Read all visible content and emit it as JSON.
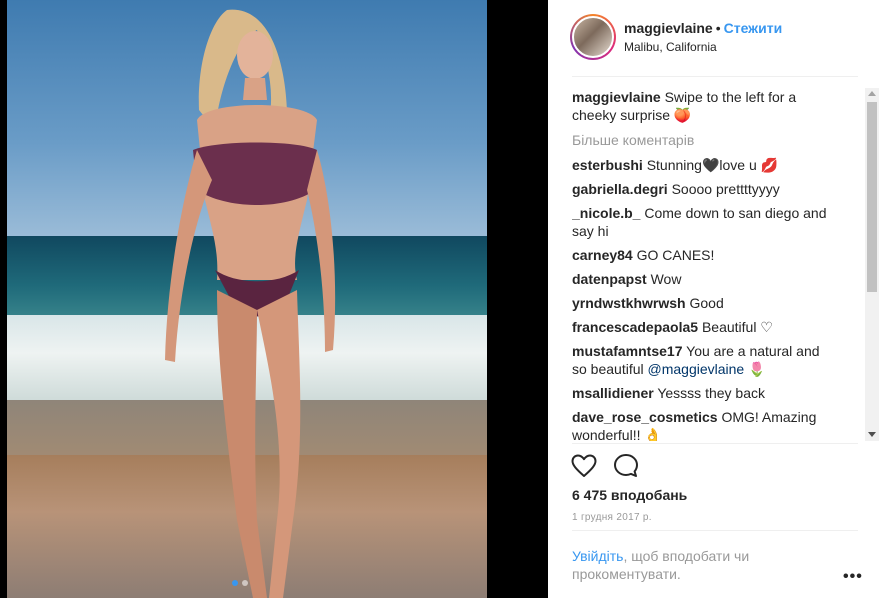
{
  "post": {
    "username": "maggievlaine",
    "separator": "•",
    "follow_label": "Стежити",
    "location": "Malibu, California",
    "caption_user": "maggievlaine",
    "caption_text": "Swipe to the left for a cheeky surprise 🍑",
    "more_comments_label": "Більше коментарів",
    "likes_text": "6 475 вподобань",
    "date_text": "1 грудня 2017 р.",
    "login_link": "Увійдіть",
    "login_text": ", щоб вподобати чи прокоментувати.",
    "more_options": "•••"
  },
  "comments": [
    {
      "user": "esterbushi",
      "text": "Stunning🖤love u 💋"
    },
    {
      "user": "gabriella.degri",
      "text": "Soooo prettttyyyy"
    },
    {
      "user": "_nicole.b_",
      "text": "Come down to san diego and say hi"
    },
    {
      "user": "carney84",
      "text": "GO CANES!"
    },
    {
      "user": "datenpapst",
      "text": "Wow"
    },
    {
      "user": "yrndwstkhwrwsh",
      "text": "Good"
    },
    {
      "user": "francescadepaola5",
      "text": "Beautiful ♡"
    },
    {
      "user": "mustafamntse17",
      "text": "You are a natural and so beautiful",
      "mention": "@maggievlaine",
      "suffix": " 🌷"
    },
    {
      "user": "msallidiener",
      "text": "Yessss they back"
    },
    {
      "user": "dave_rose_cosmetics",
      "text": "OMG! Amazing wonderful!! 👌"
    }
  ],
  "carousel": {
    "count": 2,
    "active_index": 0
  },
  "icons": {
    "like": "heart-outline-icon",
    "comment": "comment-bubble-icon",
    "more": "more-options-icon"
  },
  "colors": {
    "link": "#3897f0",
    "text": "#262626",
    "muted": "#999999",
    "mention": "#003569"
  }
}
